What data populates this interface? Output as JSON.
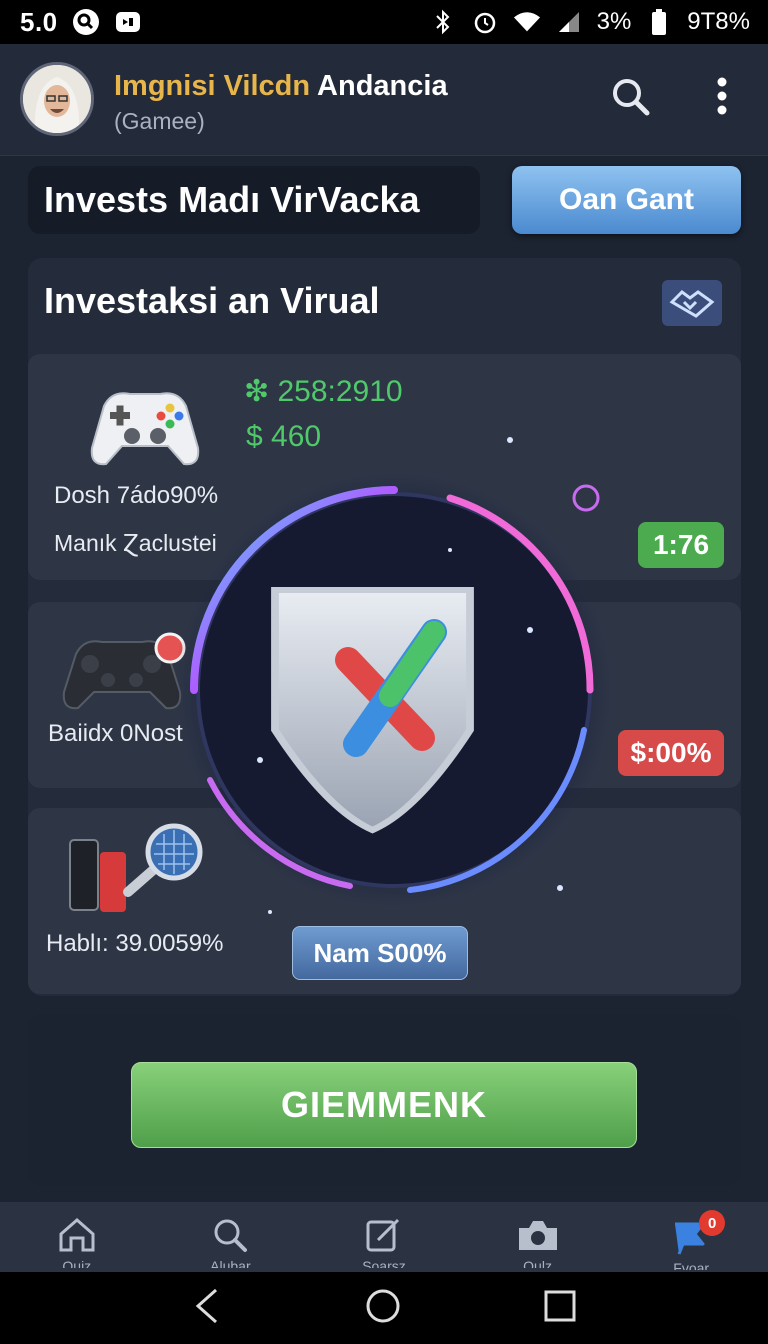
{
  "status_bar": {
    "time": "5.0",
    "battery_percent": "3%",
    "extra": "9T8%"
  },
  "header": {
    "title_highlight": "Imgnisi Vilcdn",
    "title_rest": "Andancia",
    "subtitle": "(Gamee)"
  },
  "top": {
    "title": "Invests Madı VirVacka",
    "button_label": "Oan Gant"
  },
  "panel": {
    "title": "Investaksi an Virual",
    "icon": "handshake-icon"
  },
  "cards": [
    {
      "icon": "gamepad-white-icon",
      "value1": "❇ 258:2910",
      "value2": "$ 460",
      "line1": "Dosh 7ádo90%",
      "line2": "Manık Ɀaclustei",
      "badge": "1:76"
    },
    {
      "icon": "gamepad-black-icon",
      "line1": "Baiidx 0Nost",
      "badge": "$:00%"
    },
    {
      "icon": "phone-magnifier-icon",
      "line1": "Hablı: 39.0059%",
      "badge": "Nam S00%"
    }
  ],
  "cta": {
    "label": "GIEMMENK"
  },
  "bottom_nav": [
    {
      "icon": "home-icon",
      "label": "Ouiz"
    },
    {
      "icon": "search-icon",
      "label": "Alubar"
    },
    {
      "icon": "edit-icon",
      "label": "Soarsz"
    },
    {
      "icon": "camera-icon",
      "label": "Oulz"
    },
    {
      "icon": "flag-icon",
      "label": "Fvoar",
      "badge": "0"
    }
  ],
  "colors": {
    "background": "#1c2331",
    "accent_blue": "#4b8ad0",
    "accent_green": "#4caa4f",
    "accent_red": "#d64a4a",
    "title_gold": "#e8b54a"
  }
}
